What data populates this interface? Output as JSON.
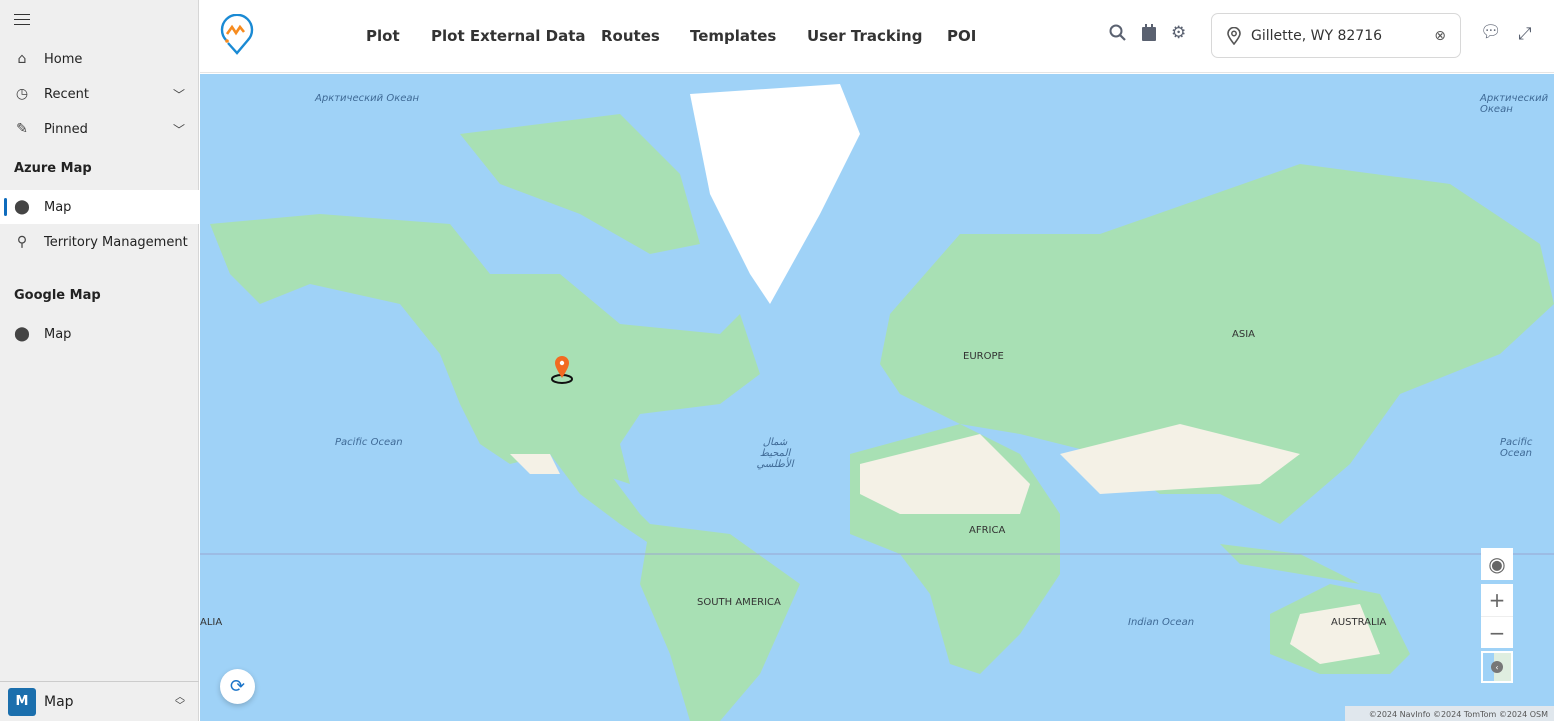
{
  "sidebar": {
    "items": [
      {
        "label": "Home",
        "icon": "home-icon"
      },
      {
        "label": "Recent",
        "icon": "clock-icon"
      },
      {
        "label": "Pinned",
        "icon": "pin-icon"
      }
    ],
    "sections": [
      {
        "title": "Azure Map",
        "items": [
          {
            "label": "Map",
            "icon": "map-marker-icon",
            "active": true
          },
          {
            "label": "Territory Management",
            "icon": "territory-icon"
          }
        ]
      },
      {
        "title": "Google Map",
        "items": [
          {
            "label": "Map",
            "icon": "map-marker-icon"
          }
        ]
      }
    ],
    "footer": {
      "badge": "M",
      "label": "Map"
    }
  },
  "header": {
    "menu": [
      "Plot",
      "Plot External Data",
      "Routes",
      "Templates",
      "User Tracking",
      "POI"
    ],
    "search_value": "Gillette, WY 82716"
  },
  "map": {
    "labels": {
      "arctic": "Арктический Океан",
      "pacific": "Pacific Ocean",
      "atlantic": "شمال المحيط الأطلسي",
      "indian": "Indian Ocean",
      "europe": "EUROPE",
      "asia": "ASIA",
      "africa": "AFRICA",
      "south_america": "SOUTH AMERICA",
      "australia": "AUSTRALIA",
      "australia_left": "ALIA"
    },
    "attribution": "©2024 NavInfo  ©2024 TomTom  ©2024 OSM",
    "colors": {
      "water": "#9fd2f7",
      "land": "#a8e0b4",
      "desert": "#f4f1e6",
      "marker": "#f26b21"
    }
  }
}
